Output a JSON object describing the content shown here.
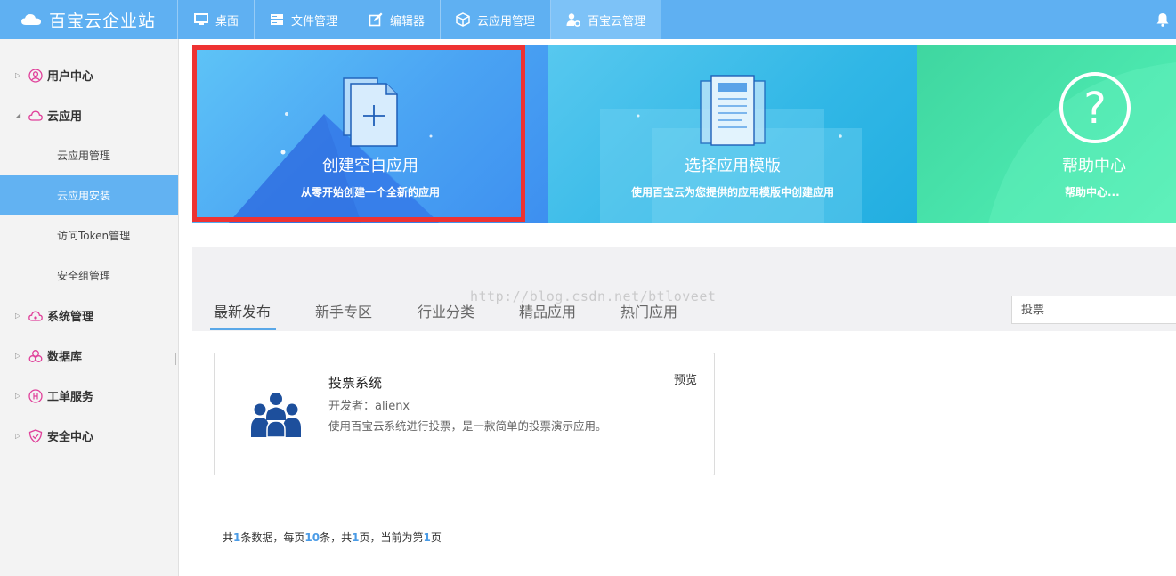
{
  "brand": {
    "title": "百宝云企业站"
  },
  "nav": {
    "tabs": [
      {
        "label": "桌面",
        "icon": "monitor-icon"
      },
      {
        "label": "文件管理",
        "icon": "server-icon"
      },
      {
        "label": "编辑器",
        "icon": "edit-icon"
      },
      {
        "label": "云应用管理",
        "icon": "cube-icon"
      },
      {
        "label": "百宝云管理",
        "icon": "user-gear-icon"
      }
    ],
    "active_index": 4
  },
  "sidebar": {
    "items": [
      {
        "label": "用户中心",
        "icon": "user-circle-icon"
      },
      {
        "label": "云应用",
        "icon": "cloud-icon"
      },
      {
        "label": "系统管理",
        "icon": "cloud-gear-icon"
      },
      {
        "label": "数据库",
        "icon": "database-icon"
      },
      {
        "label": "工单服务",
        "icon": "ticket-icon"
      },
      {
        "label": "安全中心",
        "icon": "shield-icon"
      }
    ],
    "subitems": [
      {
        "label": "云应用管理"
      },
      {
        "label": "云应用安装"
      },
      {
        "label": "访问Token管理"
      },
      {
        "label": "安全组管理"
      }
    ]
  },
  "banners": [
    {
      "title": "创建空白应用",
      "subtitle": "从零开始创建一个全新的应用"
    },
    {
      "title": "选择应用模版",
      "subtitle": "使用百宝云为您提供的应用模版中创建应用"
    },
    {
      "title": "帮助中心",
      "subtitle": "帮助中心..."
    }
  ],
  "tabs": [
    "最新发布",
    "新手专区",
    "行业分类",
    "精品应用",
    "热门应用"
  ],
  "search": {
    "value": "",
    "placeholder": "投票"
  },
  "watermark": "http://blog.csdn.net/btloveet",
  "card": {
    "title": "投票系统",
    "developer": "开发者：alienx",
    "description": "使用百宝云系统进行投票，是一款简单的投票演示应用。",
    "preview_label": "预览"
  },
  "pager": {
    "prefix": "共",
    "total": "1",
    "mid1": "条数据，每页",
    "per_page": "10",
    "mid2": "条，共",
    "pages": "1",
    "mid3": "页，当前为第",
    "current": "1",
    "suffix": "页"
  },
  "colors": {
    "topbar": "#5fb0f2",
    "sidebar_active": "#62b2f2",
    "highlight_box": "#ee3232",
    "accent_number": "#4a9be6"
  }
}
